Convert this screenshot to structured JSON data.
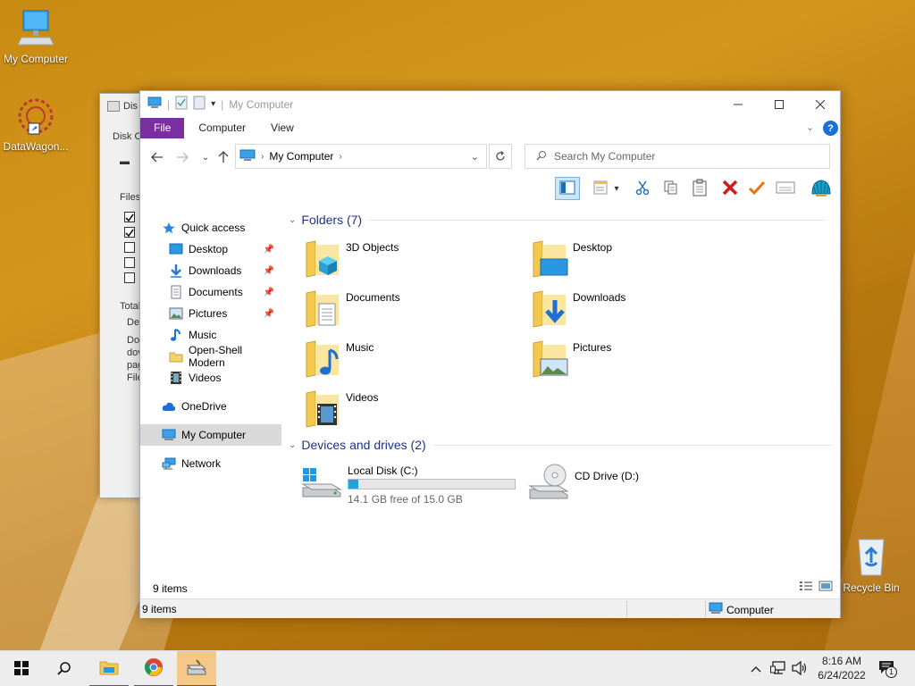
{
  "desktop": {
    "icons": [
      {
        "label": "My Computer"
      },
      {
        "label": "DataWagon..."
      },
      {
        "label": "Recycle Bin"
      }
    ]
  },
  "background_window": {
    "title": "Dis",
    "labels": [
      "Disk C",
      "Files",
      "Total",
      "De",
      "Do",
      "dov",
      "pag",
      "File"
    ]
  },
  "window": {
    "title": "My Computer",
    "ribbon_tabs": [
      "File",
      "Computer",
      "View"
    ],
    "address": "My Computer",
    "search_placeholder": "Search My Computer",
    "accent": "#7a2fa0"
  },
  "nav": {
    "items": [
      {
        "label": "Quick access",
        "icon": "star-icon"
      },
      {
        "label": "Desktop",
        "icon": "desktop-folder-icon",
        "pinned": true
      },
      {
        "label": "Downloads",
        "icon": "download-arrow-icon",
        "pinned": true
      },
      {
        "label": "Documents",
        "icon": "document-icon",
        "pinned": true
      },
      {
        "label": "Pictures",
        "icon": "pictures-icon",
        "pinned": true
      },
      {
        "label": "Music",
        "icon": "music-note-icon"
      },
      {
        "label": "Open-Shell Modern",
        "icon": "folder-icon"
      },
      {
        "label": "Videos",
        "icon": "film-icon"
      },
      {
        "label": "OneDrive",
        "icon": "cloud-icon"
      },
      {
        "label": "My Computer",
        "icon": "computer-icon",
        "selected": true
      },
      {
        "label": "Network",
        "icon": "network-icon"
      }
    ]
  },
  "content": {
    "folders_header": "Folders (7)",
    "folders": [
      {
        "name": "3D Objects",
        "icon": "3d-objects-folder-icon"
      },
      {
        "name": "Desktop",
        "icon": "desktop-folder-icon"
      },
      {
        "name": "Documents",
        "icon": "documents-folder-icon"
      },
      {
        "name": "Downloads",
        "icon": "downloads-folder-icon"
      },
      {
        "name": "Music",
        "icon": "music-folder-icon"
      },
      {
        "name": "Pictures",
        "icon": "pictures-folder-icon"
      },
      {
        "name": "Videos",
        "icon": "videos-folder-icon"
      }
    ],
    "drives_header": "Devices and drives (2)",
    "drives": [
      {
        "name": "Local Disk (C:)",
        "free_text": "14.1 GB free of 15.0 GB",
        "used_fraction": 0.06
      },
      {
        "name": "CD Drive (D:)"
      }
    ]
  },
  "status": {
    "items_inner": "9 items",
    "items_bar": "9 items",
    "location": "Computer"
  },
  "taskbar": {
    "time": "8:16 AM",
    "date": "6/24/2022",
    "notification_count": "1"
  }
}
